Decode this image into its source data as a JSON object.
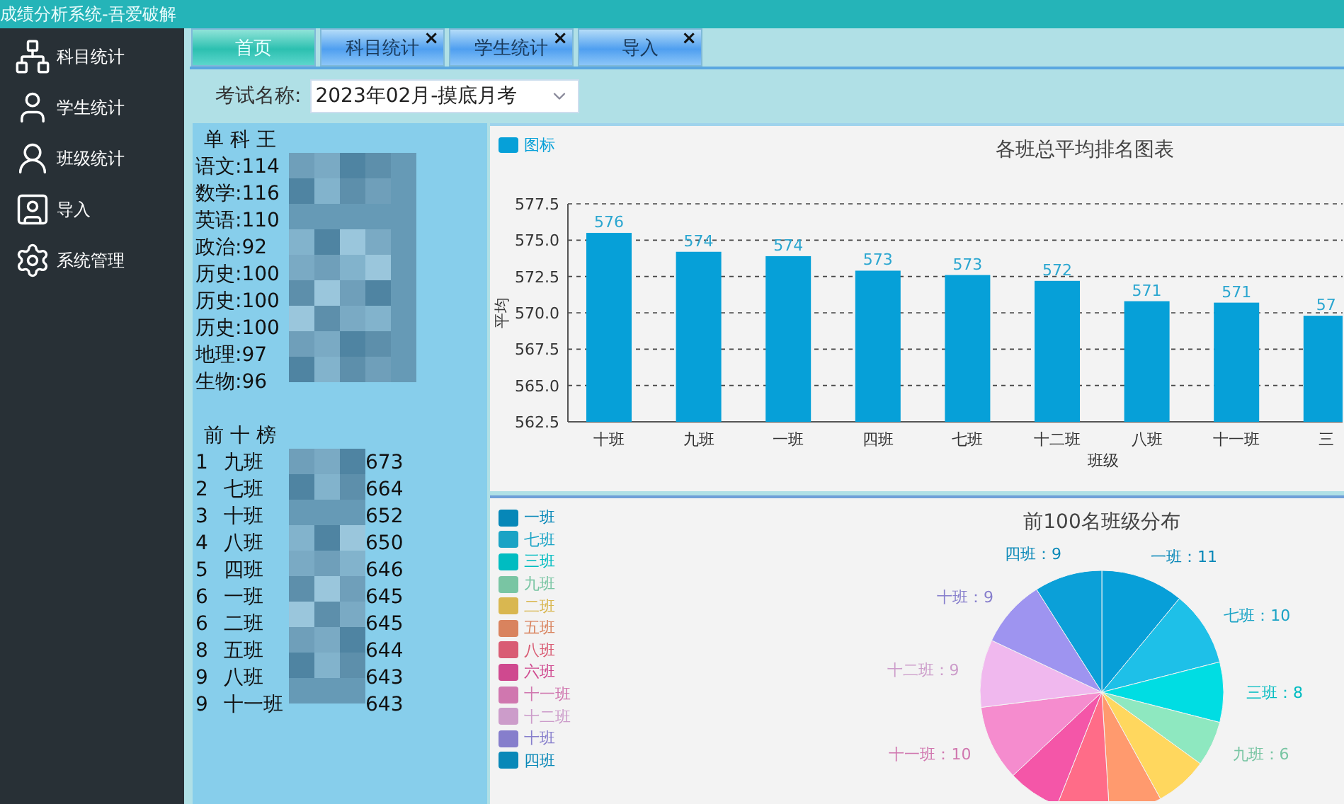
{
  "window": {
    "title": "成绩分析系统-吾爱破解"
  },
  "sidebar": {
    "items": [
      {
        "label": "科目统计"
      },
      {
        "label": "学生统计"
      },
      {
        "label": "班级统计"
      },
      {
        "label": "导入"
      },
      {
        "label": "系统管理"
      }
    ]
  },
  "tabs": [
    {
      "label": "首页",
      "selected": true,
      "closable": false
    },
    {
      "label": "科目统计",
      "selected": false,
      "closable": true
    },
    {
      "label": "学生统计",
      "selected": false,
      "closable": true
    },
    {
      "label": "导入",
      "selected": false,
      "closable": true
    }
  ],
  "close_glyph": "×",
  "exam": {
    "label": "考试名称:",
    "value": "2023年02月-摸底月考"
  },
  "subject_kings": {
    "title": "单 科 王",
    "items": [
      "语文:114",
      "数学:116",
      "英语:110",
      "政治:92",
      "历史:100",
      "历史:100",
      "历史:100",
      "地理:97",
      "生物:96"
    ]
  },
  "top_ten": {
    "title": "前 十 榜",
    "rows": [
      {
        "rank": "1",
        "class_name": "九班",
        "score": "673"
      },
      {
        "rank": "2",
        "class_name": "七班",
        "score": "664"
      },
      {
        "rank": "3",
        "class_name": "十班",
        "score": "652"
      },
      {
        "rank": "4",
        "class_name": "八班",
        "score": "650"
      },
      {
        "rank": "5",
        "class_name": "四班",
        "score": "646"
      },
      {
        "rank": "6",
        "class_name": "一班",
        "score": "645"
      },
      {
        "rank": "6",
        "class_name": "二班",
        "score": "645"
      },
      {
        "rank": "8",
        "class_name": "五班",
        "score": "644"
      },
      {
        "rank": "9",
        "class_name": "八班",
        "score": "643"
      },
      {
        "rank": "9",
        "class_name": "十一班",
        "score": "643"
      }
    ]
  },
  "bar_chart": {
    "chart_data": {
      "type": "bar",
      "title": "各班总平均排名图表",
      "xlabel": "班级",
      "ylabel": "平均",
      "grid": true,
      "categories": [
        "十班",
        "九班",
        "一班",
        "四班",
        "七班",
        "十二班",
        "八班",
        "十一班",
        "三"
      ],
      "series": [
        {
          "name": "图标",
          "color": "#06a0d8",
          "values": [
            575.5,
            574.2,
            573.9,
            572.9,
            572.6,
            572.2,
            570.8,
            570.7,
            569.8
          ]
        }
      ],
      "ylim": [
        562.5,
        577.5
      ],
      "yticks": [
        {
          "value": 562.5,
          "label": "562.5"
        },
        {
          "value": 565,
          "label": "565.0"
        },
        {
          "value": 567.5,
          "label": "567.5"
        },
        {
          "value": 570,
          "label": "570.0"
        },
        {
          "value": 572.5,
          "label": "572.5"
        },
        {
          "value": 575,
          "label": "575.0"
        },
        {
          "value": 577.5,
          "label": "577.5"
        }
      ],
      "value_labels": [
        "576",
        "574",
        "574",
        "573",
        "573",
        "572",
        "571",
        "571",
        "57"
      ]
    }
  },
  "pie_chart": {
    "chart_data": {
      "type": "pie",
      "title": "前100名班级分布",
      "categories": [
        "一班",
        "七班",
        "三班",
        "九班",
        "二班",
        "五班",
        "八班",
        "六班",
        "十一班",
        "十二班",
        "十班",
        "四班"
      ],
      "values": [
        11,
        10,
        8,
        6,
        7,
        7,
        7,
        7,
        10,
        9,
        9,
        9
      ],
      "colors": [
        "#079fd8",
        "#1ec0e8",
        "#00dde3",
        "#8ee8c0",
        "#ffd75e",
        "#ff9a6e",
        "#ff6c88",
        "#f456a8",
        "#f58cce",
        "#f0b8ee",
        "#9e94f0",
        "#0ba0d8"
      ],
      "value_labels": [
        "一班：11",
        "七班：10",
        "三班：8",
        "九班：6",
        null,
        null,
        null,
        null,
        "十一班：10",
        "十二班：9",
        "十班：9",
        "四班：9"
      ]
    }
  }
}
